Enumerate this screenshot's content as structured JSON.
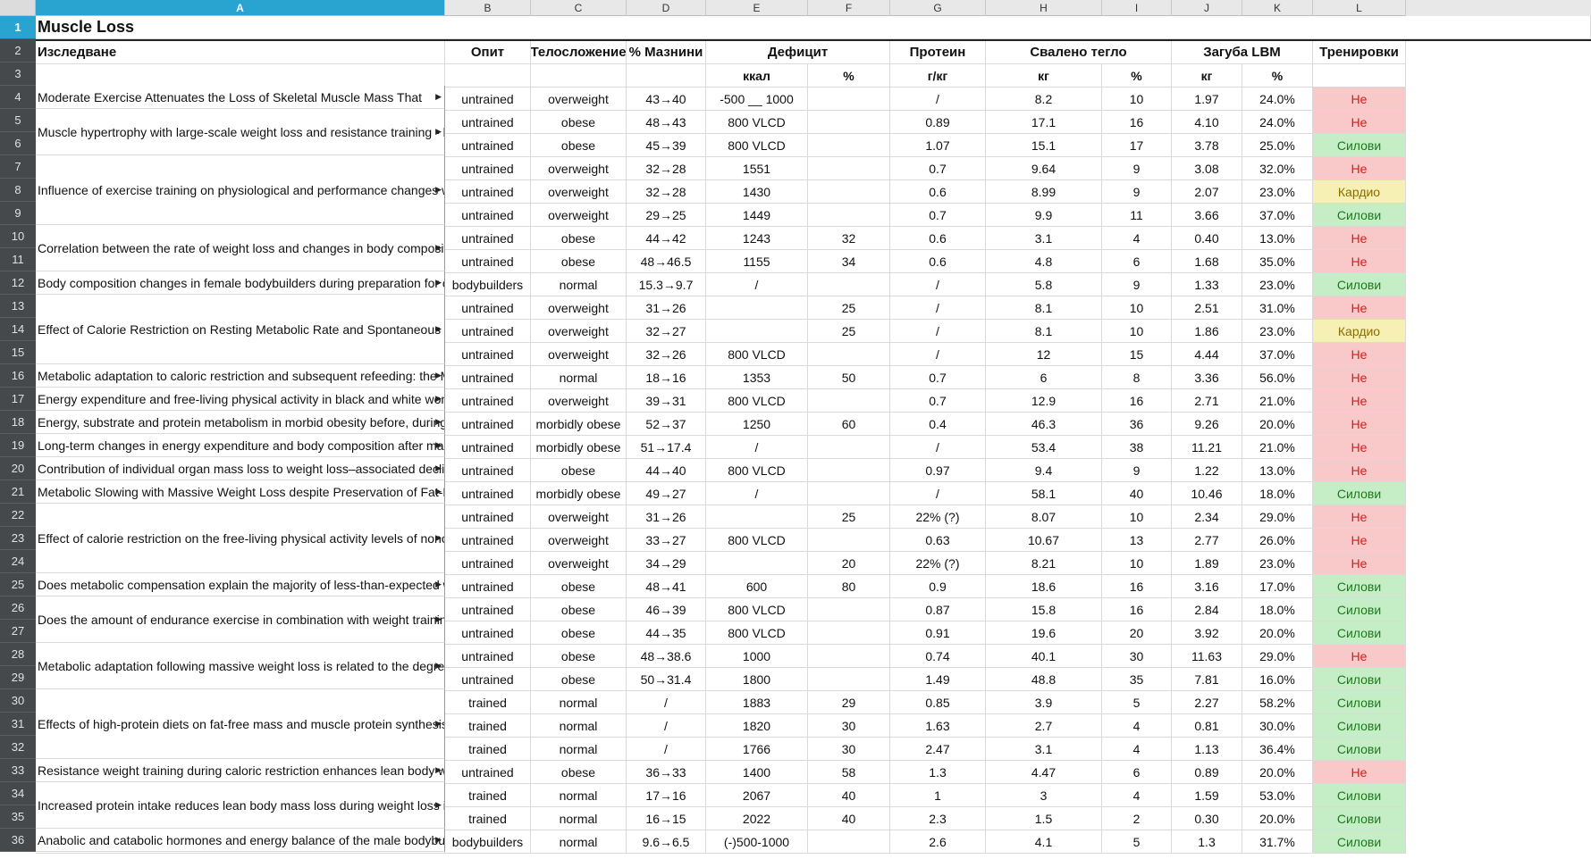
{
  "app": {
    "colors": {
      "selection": "#29a3cf",
      "red_fill": "#f9c8c8",
      "green_fill": "#c6eec6",
      "yellow_fill": "#f6f0b4"
    }
  },
  "columns": [
    "A",
    "B",
    "C",
    "D",
    "E",
    "F",
    "G",
    "H",
    "I",
    "J",
    "K",
    "L"
  ],
  "selected_column": "A",
  "selected_row": "1",
  "sheet": {
    "title": "Muscle Loss",
    "header": {
      "study": "Изследване",
      "experience": "Опит",
      "build": "Телосложение",
      "fat": "% Мазнини",
      "deficit": "Дефицит",
      "protein": "Протеин",
      "weight_lost": "Свалено тегло",
      "lbm_loss": "Загуба LBM",
      "training": "Тренировки"
    },
    "units": {
      "kcal": "ккал",
      "pct1": "%",
      "gkg": "г/кг",
      "kg1": "кг",
      "pct2": "%",
      "kg2": "кг",
      "pct3": "%"
    },
    "studies": [
      {
        "title": "Moderate Exercise Attenuates the Loss of Skeletal Muscle Mass That",
        "rows": 1
      },
      {
        "title": "Muscle hypertrophy with large-scale weight loss and resistance training - h",
        "rows": 2
      },
      {
        "title": "Influence of exercise training on physiological and performance changes with w",
        "rows": 3
      },
      {
        "title": "Correlation between the rate of weight loss and changes in body composition i",
        "rows": 2
      },
      {
        "title": "Body composition changes in female bodybuilders during preparation for compe",
        "rows": 1
      },
      {
        "title": "Effect of Calorie Restriction on Resting Metabolic Rate and Spontaneous Physic",
        "rows": 3
      },
      {
        "title": "Metabolic adaptation to caloric restriction and subsequent refeeding: the Minnes",
        "rows": 1
      },
      {
        "title": "Energy expenditure and free-living physical activity in black and white women: o",
        "rows": 1
      },
      {
        "title": "Energy, substrate and protein metabolism in morbid obesity before, during and a",
        "rows": 1
      },
      {
        "title": "Long-term changes in energy expenditure and body composition after massive w",
        "rows": 1
      },
      {
        "title": "Contribution of individual organ mass loss to weight loss–associated decline in r",
        "rows": 1
      },
      {
        "title": "Metabolic Slowing with Massive Weight Loss despite Preservation of Fat-Free M",
        "rows": 1
      },
      {
        "title": "Effect of calorie restriction on the free-living physical activity levels of nonobe",
        "rows": 3
      },
      {
        "title": "Does metabolic compensation explain the majority of less-than-expected weight",
        "rows": 1
      },
      {
        "title": "Does the amount of endurance exercise in combination with weight training and",
        "rows": 2
      },
      {
        "title": "Metabolic adaptation following massive weight loss is related to the degree of e",
        "rows": 2
      },
      {
        "title": "Effects of high-protein diets on fat-free mass and muscle protein synthesis follo",
        "rows": 3
      },
      {
        "title": "Resistance weight training during caloric restriction enhances lean body weight",
        "rows": 1
      },
      {
        "title": "Increased protein intake reduces lean body mass loss during weight loss in athl",
        "rows": 2
      },
      {
        "title": "Anabolic and catabolic hormones and energy balance of the male bodybuilders",
        "rows": 1
      }
    ],
    "rows": [
      {
        "n": "4",
        "b": "untrained",
        "c": "overweight",
        "d": "43→40",
        "e": "-500 __ 1000",
        "f": "",
        "g": "/",
        "h": "8.2",
        "i": "10",
        "j": "1.97",
        "k": "24.0%",
        "l": "Не",
        "t": "red"
      },
      {
        "n": "5",
        "b": "untrained",
        "c": "obese",
        "d": "48→43",
        "e": "800 VLCD",
        "f": "",
        "g": "0.89",
        "h": "17.1",
        "i": "16",
        "j": "4.10",
        "k": "24.0%",
        "l": "Не",
        "t": "red"
      },
      {
        "n": "6",
        "b": "untrained",
        "c": "obese",
        "d": "45→39",
        "e": "800 VLCD",
        "f": "",
        "g": "1.07",
        "h": "15.1",
        "i": "17",
        "j": "3.78",
        "k": "25.0%",
        "l": "Силови",
        "t": "green"
      },
      {
        "n": "7",
        "b": "untrained",
        "c": "overweight",
        "d": "32→28",
        "e": "1551",
        "f": "",
        "g": "0.7",
        "h": "9.64",
        "i": "9",
        "j": "3.08",
        "k": "32.0%",
        "l": "Не",
        "t": "red"
      },
      {
        "n": "8",
        "b": "untrained",
        "c": "overweight",
        "d": "32→28",
        "e": "1430",
        "f": "",
        "g": "0.6",
        "h": "8.99",
        "i": "9",
        "j": "2.07",
        "k": "23.0%",
        "l": "Кардио",
        "t": "yellow"
      },
      {
        "n": "9",
        "b": "untrained",
        "c": "overweight",
        "d": "29→25",
        "e": "1449",
        "f": "",
        "g": "0.7",
        "h": "9.9",
        "i": "11",
        "j": "3.66",
        "k": "37.0%",
        "l": "Силови",
        "t": "green"
      },
      {
        "n": "10",
        "b": "untrained",
        "c": "obese",
        "d": "44→42",
        "e": "1243",
        "f": "32",
        "g": "0.6",
        "h": "3.1",
        "i": "4",
        "j": "0.40",
        "k": "13.0%",
        "l": "Не",
        "t": "red"
      },
      {
        "n": "11",
        "b": "untrained",
        "c": "obese",
        "d": "48→46.5",
        "e": "1155",
        "f": "34",
        "g": "0.6",
        "h": "4.8",
        "i": "6",
        "j": "1.68",
        "k": "35.0%",
        "l": "Не",
        "t": "red"
      },
      {
        "n": "12",
        "b": "bodybuilders",
        "c": "normal",
        "d": "15.3→9.7",
        "e": "/",
        "f": "",
        "g": "/",
        "h": "5.8",
        "i": "9",
        "j": "1.33",
        "k": "23.0%",
        "l": "Силови",
        "t": "green"
      },
      {
        "n": "13",
        "b": "untrained",
        "c": "overweight",
        "d": "31→26",
        "e": "",
        "f": "25",
        "g": "/",
        "h": "8.1",
        "i": "10",
        "j": "2.51",
        "k": "31.0%",
        "l": "Не",
        "t": "red"
      },
      {
        "n": "14",
        "b": "untrained",
        "c": "overweight",
        "d": "32→27",
        "e": "",
        "f": "25",
        "g": "/",
        "h": "8.1",
        "i": "10",
        "j": "1.86",
        "k": "23.0%",
        "l": "Кардио",
        "t": "yellow"
      },
      {
        "n": "15",
        "b": "untrained",
        "c": "overweight",
        "d": "32→26",
        "e": "800  VLCD",
        "f": "",
        "g": "/",
        "h": "12",
        "i": "15",
        "j": "4.44",
        "k": "37.0%",
        "l": "Не",
        "t": "red"
      },
      {
        "n": "16",
        "b": "untrained",
        "c": "normal",
        "d": "18→16",
        "e": "1353",
        "f": "50",
        "g": "0.7",
        "h": "6",
        "i": "8",
        "j": "3.36",
        "k": "56.0%",
        "l": "Не",
        "t": "red"
      },
      {
        "n": "17",
        "b": "untrained",
        "c": "overweight",
        "d": "39→31",
        "e": "800  VLCD",
        "f": "",
        "g": "0.7",
        "h": "12.9",
        "i": "16",
        "j": "2.71",
        "k": "21.0%",
        "l": "Не",
        "t": "red"
      },
      {
        "n": "18",
        "b": "untrained",
        "c": "morbidly obese",
        "d": "52→37",
        "e": "1250",
        "f": "60",
        "g": "0.4",
        "h": "46.3",
        "i": "36",
        "j": "9.26",
        "k": "20.0%",
        "l": "Не",
        "t": "red"
      },
      {
        "n": "19",
        "b": "untrained",
        "c": "morbidly obese",
        "d": "51→17.4",
        "e": "/",
        "f": "",
        "g": "/",
        "h": "53.4",
        "i": "38",
        "j": "11.21",
        "k": "21.0%",
        "l": "Не",
        "t": "red"
      },
      {
        "n": "20",
        "b": "untrained",
        "c": "obese",
        "d": "44→40",
        "e": "800  VLCD",
        "f": "",
        "g": "0.97",
        "h": "9.4",
        "i": "9",
        "j": "1.22",
        "k": "13.0%",
        "l": "Не",
        "t": "red"
      },
      {
        "n": "21",
        "b": "untrained",
        "c": "morbidly obese",
        "d": "49→27",
        "e": "/",
        "f": "",
        "g": "/",
        "h": "58.1",
        "i": "40",
        "j": "10.46",
        "k": "18.0%",
        "l": "Силови",
        "t": "green"
      },
      {
        "n": "22",
        "b": "untrained",
        "c": "overweight",
        "d": "31→26",
        "e": "",
        "f": "25",
        "g": "22% (?)",
        "h": "8.07",
        "i": "10",
        "j": "2.34",
        "k": "29.0%",
        "l": "Не",
        "t": "red"
      },
      {
        "n": "23",
        "b": "untrained",
        "c": "overweight",
        "d": "33→27",
        "e": "800  VLCD",
        "f": "",
        "g": "0.63",
        "h": "10.67",
        "i": "13",
        "j": "2.77",
        "k": "26.0%",
        "l": "Не",
        "t": "red"
      },
      {
        "n": "24",
        "b": "untrained",
        "c": "overweight",
        "d": "34→29",
        "e": "",
        "f": "20",
        "g": "22% (?)",
        "h": "8.21",
        "i": "10",
        "j": "1.89",
        "k": "23.0%",
        "l": "Не",
        "t": "red"
      },
      {
        "n": "25",
        "b": "untrained",
        "c": "obese",
        "d": "48→41",
        "e": "600",
        "f": "80",
        "g": "0.9",
        "h": "18.6",
        "i": "16",
        "j": "3.16",
        "k": "17.0%",
        "l": "Силови",
        "t": "green"
      },
      {
        "n": "26",
        "b": "untrained",
        "c": "obese",
        "d": "46→39",
        "e": "800  VLCD",
        "f": "",
        "g": "0.87",
        "h": "15.8",
        "i": "16",
        "j": "2.84",
        "k": "18.0%",
        "l": "Силови",
        "t": "green"
      },
      {
        "n": "27",
        "b": "untrained",
        "c": "obese",
        "d": "44→35",
        "e": "800  VLCD",
        "f": "",
        "g": "0.91",
        "h": "19.6",
        "i": "20",
        "j": "3.92",
        "k": "20.0%",
        "l": "Силови",
        "t": "green"
      },
      {
        "n": "28",
        "b": "untrained",
        "c": "obese",
        "d": "48→38.6",
        "e": "1000",
        "f": "",
        "g": "0.74",
        "h": "40.1",
        "i": "30",
        "j": "11.63",
        "k": "29.0%",
        "l": "Не",
        "t": "red"
      },
      {
        "n": "29",
        "b": "untrained",
        "c": "obese",
        "d": "50→31.4",
        "e": "1800",
        "f": "",
        "g": "1.49",
        "h": "48.8",
        "i": "35",
        "j": "7.81",
        "k": "16.0%",
        "l": "Силови",
        "t": "green"
      },
      {
        "n": "30",
        "b": "trained",
        "c": "normal",
        "d": "/",
        "e": "1883",
        "f": "29",
        "g": "0.85",
        "h": "3.9",
        "i": "5",
        "j": "2.27",
        "k": "58.2%",
        "l": "Силови",
        "t": "green"
      },
      {
        "n": "31",
        "b": "trained",
        "c": "normal",
        "d": "/",
        "e": "1820",
        "f": "30",
        "g": "1.63",
        "h": "2.7",
        "i": "4",
        "j": "0.81",
        "k": "30.0%",
        "l": "Силови",
        "t": "green"
      },
      {
        "n": "32",
        "b": "trained",
        "c": "normal",
        "d": "/",
        "e": "1766",
        "f": "30",
        "g": "2.47",
        "h": "3.1",
        "i": "4",
        "j": "1.13",
        "k": "36.4%",
        "l": "Силови",
        "t": "green"
      },
      {
        "n": "33",
        "b": "untrained",
        "c": "obese",
        "d": "36→33",
        "e": "1400",
        "f": "58",
        "g": "1.3",
        "h": "4.47",
        "i": "6",
        "j": "0.89",
        "k": "20.0%",
        "l": "Не",
        "t": "red"
      },
      {
        "n": "34",
        "b": "trained",
        "c": "normal",
        "d": "17→16",
        "e": "2067",
        "f": "40",
        "g": "1",
        "h": "3",
        "i": "4",
        "j": "1.59",
        "k": "53.0%",
        "l": "Силови",
        "t": "green"
      },
      {
        "n": "35",
        "b": "trained",
        "c": "normal",
        "d": "16→15",
        "e": "2022",
        "f": "40",
        "g": "2.3",
        "h": "1.5",
        "i": "2",
        "j": "0.30",
        "k": "20.0%",
        "l": "Силови",
        "t": "green"
      },
      {
        "n": "36",
        "b": "bodybuilders",
        "c": "normal",
        "d": "9.6→6.5",
        "e": "(-)500-1000",
        "f": "",
        "g": "2.6",
        "h": "4.1",
        "i": "5",
        "j": "1.3",
        "k": "31.7%",
        "l": "Силови",
        "t": "green"
      }
    ]
  }
}
